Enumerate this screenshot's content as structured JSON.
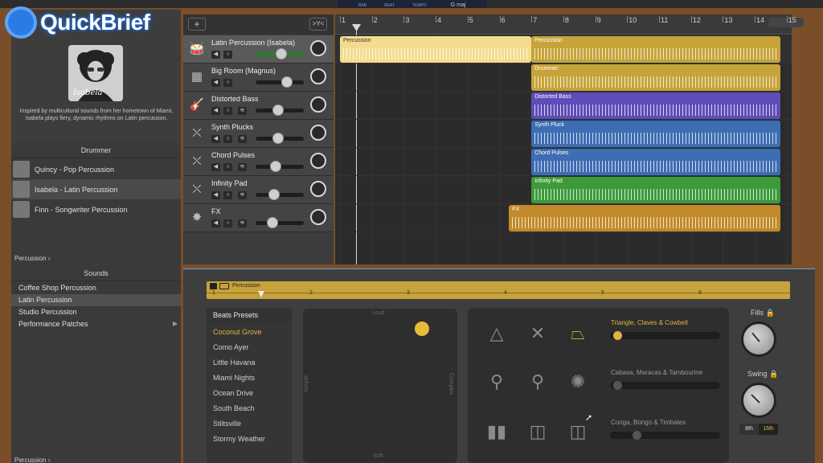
{
  "lcd": {
    "bar": "BAR",
    "beat": "BEAT",
    "tempo": "TEMPO",
    "key": "G maj"
  },
  "watermark": {
    "text": "QuickBrief"
  },
  "library": {
    "portrait_caption": "Isabela",
    "bio": "Inspired by multicultural sounds from her hometown of Miami, Isabela plays fiery, dynamic rhythms on Latin percussion.",
    "drummer_header": "Drummer",
    "drummers": [
      {
        "name": "Quincy - Pop Percussion",
        "selected": false
      },
      {
        "name": "Isabela - Latin Percussion",
        "selected": true
      },
      {
        "name": "Finn - Songwriter Percussion",
        "selected": false
      }
    ],
    "crumb": "Percussion",
    "sounds_header": "Sounds",
    "sounds": [
      {
        "name": "Coffee Shop Percussion",
        "selected": false
      },
      {
        "name": "Latin Percussion",
        "selected": true
      },
      {
        "name": "Studio Percussion",
        "selected": false
      },
      {
        "name": "Performance Patches",
        "selected": false
      }
    ],
    "crumb_bottom": "Percussion"
  },
  "track_header": {
    "add": "+",
    "filter": ">Y<"
  },
  "tracks": [
    {
      "name": "Latin Percussion (Isabela)",
      "icon": "drum-icon",
      "glyph": "🥁",
      "volume": 0.55,
      "selected": true,
      "green": true
    },
    {
      "name": "Big Room (Magnus)",
      "icon": "drum-machine-icon",
      "glyph": "▦",
      "volume": 0.7,
      "selected": false
    },
    {
      "name": "Distorted Bass",
      "icon": "bass-guitar-icon",
      "glyph": "🎸",
      "volume": 0.45,
      "selected": false
    },
    {
      "name": "Synth Plucks",
      "icon": "synth-icon",
      "glyph": "⛌",
      "volume": 0.45,
      "selected": false
    },
    {
      "name": "Chord Pulses",
      "icon": "synth-icon",
      "glyph": "⛌",
      "volume": 0.4,
      "selected": false
    },
    {
      "name": "Infinity Pad",
      "icon": "synth-icon",
      "glyph": "⛌",
      "volume": 0.35,
      "selected": false
    },
    {
      "name": "FX",
      "icon": "sparkle-icon",
      "glyph": "✸",
      "volume": 0.3,
      "selected": false
    }
  ],
  "ruler": [
    "1",
    "2",
    "3",
    "4",
    "5",
    "6",
    "7",
    "8",
    "9",
    "10",
    "11",
    "12",
    "13",
    "14",
    "15"
  ],
  "regions": [
    {
      "label": "Percussion",
      "color": "#f3dc8e",
      "textColor": "#333",
      "lane": 0,
      "startBar": 1,
      "endBar": 7.0
    },
    {
      "label": "Percussion",
      "color": "#c6a43a",
      "textColor": "#fff",
      "lane": 0,
      "startBar": 7.0,
      "endBar": 15.0
    },
    {
      "label": "Drummer",
      "color": "#c6a43a",
      "textColor": "#fff",
      "lane": 1,
      "startBar": 7.0,
      "endBar": 15.0
    },
    {
      "label": "Distorted Bass",
      "color": "#5d4db8",
      "textColor": "#fff",
      "lane": 2,
      "startBar": 7.0,
      "endBar": 15.0
    },
    {
      "label": "Synth Pluck",
      "color": "#3d6db3",
      "textColor": "#fff",
      "lane": 3,
      "startBar": 7.0,
      "endBar": 15.0
    },
    {
      "label": "Chord Pulses",
      "color": "#3d6db3",
      "textColor": "#fff",
      "lane": 4,
      "startBar": 7.0,
      "endBar": 15.0
    },
    {
      "label": "Infinity Pad",
      "color": "#3d9a3a",
      "textColor": "#fff",
      "lane": 5,
      "startBar": 7.0,
      "endBar": 15.0
    },
    {
      "label": "FX",
      "color": "#c28a2a",
      "textColor": "#fff",
      "lane": 6,
      "startBar": 6.3,
      "endBar": 15.0
    }
  ],
  "editor": {
    "region_name": "Percussion",
    "ruler": [
      "1",
      "2",
      "3",
      "4",
      "5",
      "6"
    ],
    "presets_header": "Beats Presets",
    "presets": [
      {
        "name": "Coconut Grove",
        "selected": true
      },
      {
        "name": "Como Ayer",
        "selected": false
      },
      {
        "name": "Little Havana",
        "selected": false
      },
      {
        "name": "Miami Nights",
        "selected": false
      },
      {
        "name": "Ocean Drive",
        "selected": false
      },
      {
        "name": "South Beach",
        "selected": false
      },
      {
        "name": "Stiltsville",
        "selected": false
      },
      {
        "name": "Stormy Weather",
        "selected": false
      }
    ],
    "pad": {
      "loud": "Loud",
      "soft": "Soft",
      "simple": "Simple",
      "complex": "Complex",
      "puck_x": 0.77,
      "puck_y": 0.87
    },
    "instrument_groups": [
      {
        "label": "Triangle, Claves & Cowbell",
        "active": true,
        "level": 0.03
      },
      {
        "label": "Cabasa, Maracas & Tambourine",
        "active": false,
        "level": 0.03
      },
      {
        "label": "Conga, Bongo & Timbales",
        "active": false,
        "level": 0.22
      }
    ],
    "fills_label": "Fills",
    "swing_label": "Swing",
    "eighth": "8th",
    "sixteenth": "16th",
    "accent": "#e3b341"
  }
}
